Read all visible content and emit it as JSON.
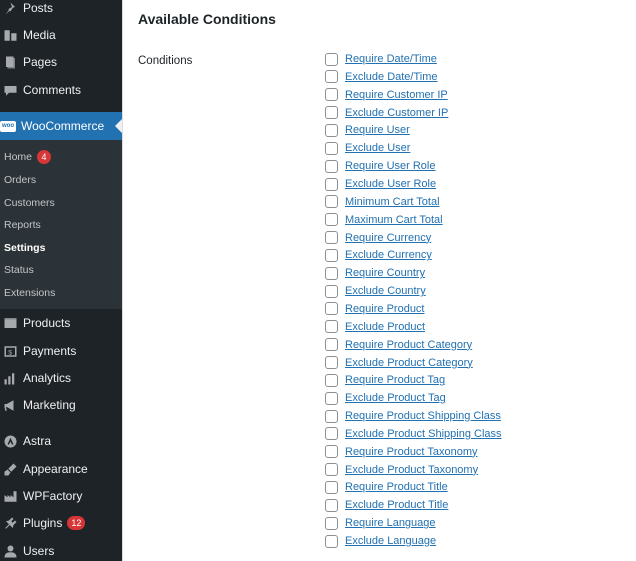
{
  "sidebar": {
    "items": [
      {
        "label": "Posts",
        "icon": "pin-icon"
      },
      {
        "label": "Media",
        "icon": "media-icon"
      },
      {
        "label": "Pages",
        "icon": "pages-icon"
      },
      {
        "label": "Comments",
        "icon": "comments-icon"
      },
      {
        "label": "WooCommerce",
        "icon": "woocommerce-icon",
        "icon_text": "woo"
      },
      {
        "label": "Products",
        "icon": "products-icon"
      },
      {
        "label": "Payments",
        "icon": "payments-icon"
      },
      {
        "label": "Analytics",
        "icon": "analytics-icon"
      },
      {
        "label": "Marketing",
        "icon": "marketing-icon"
      },
      {
        "label": "Astra",
        "icon": "astra-icon"
      },
      {
        "label": "Appearance",
        "icon": "appearance-icon"
      },
      {
        "label": "WPFactory",
        "icon": "wpfactory-icon"
      },
      {
        "label": "Plugins",
        "icon": "plugins-icon",
        "badge": "12"
      },
      {
        "label": "Users",
        "icon": "users-icon"
      }
    ],
    "submenu": [
      {
        "label": "Home",
        "badge": "4"
      },
      {
        "label": "Orders"
      },
      {
        "label": "Customers"
      },
      {
        "label": "Reports"
      },
      {
        "label": "Settings",
        "active": true
      },
      {
        "label": "Status"
      },
      {
        "label": "Extensions"
      }
    ]
  },
  "main": {
    "section_title": "Available Conditions",
    "field_label": "Conditions",
    "conditions": [
      "Require Date/Time",
      "Exclude Date/Time",
      "Require Customer IP",
      "Exclude Customer IP",
      "Require User",
      "Exclude User",
      "Require User Role",
      "Exclude User Role",
      "Minimum Cart Total",
      "Maximum Cart Total",
      "Require Currency",
      "Exclude Currency",
      "Require Country",
      "Exclude Country",
      "Require Product",
      "Exclude Product",
      "Require Product Category",
      "Exclude Product Category",
      "Require Product Tag",
      "Exclude Product Tag",
      "Require Product Shipping Class",
      "Exclude Product Shipping Class",
      "Require Product Taxonomy",
      "Exclude Product Taxonomy",
      "Require Product Title",
      "Exclude Product Title",
      "Require Language",
      "Exclude Language"
    ]
  },
  "colors": {
    "sidebar_bg": "#1d2327",
    "submenu_bg": "#2c3338",
    "accent": "#2271b1",
    "badge": "#d63638"
  }
}
